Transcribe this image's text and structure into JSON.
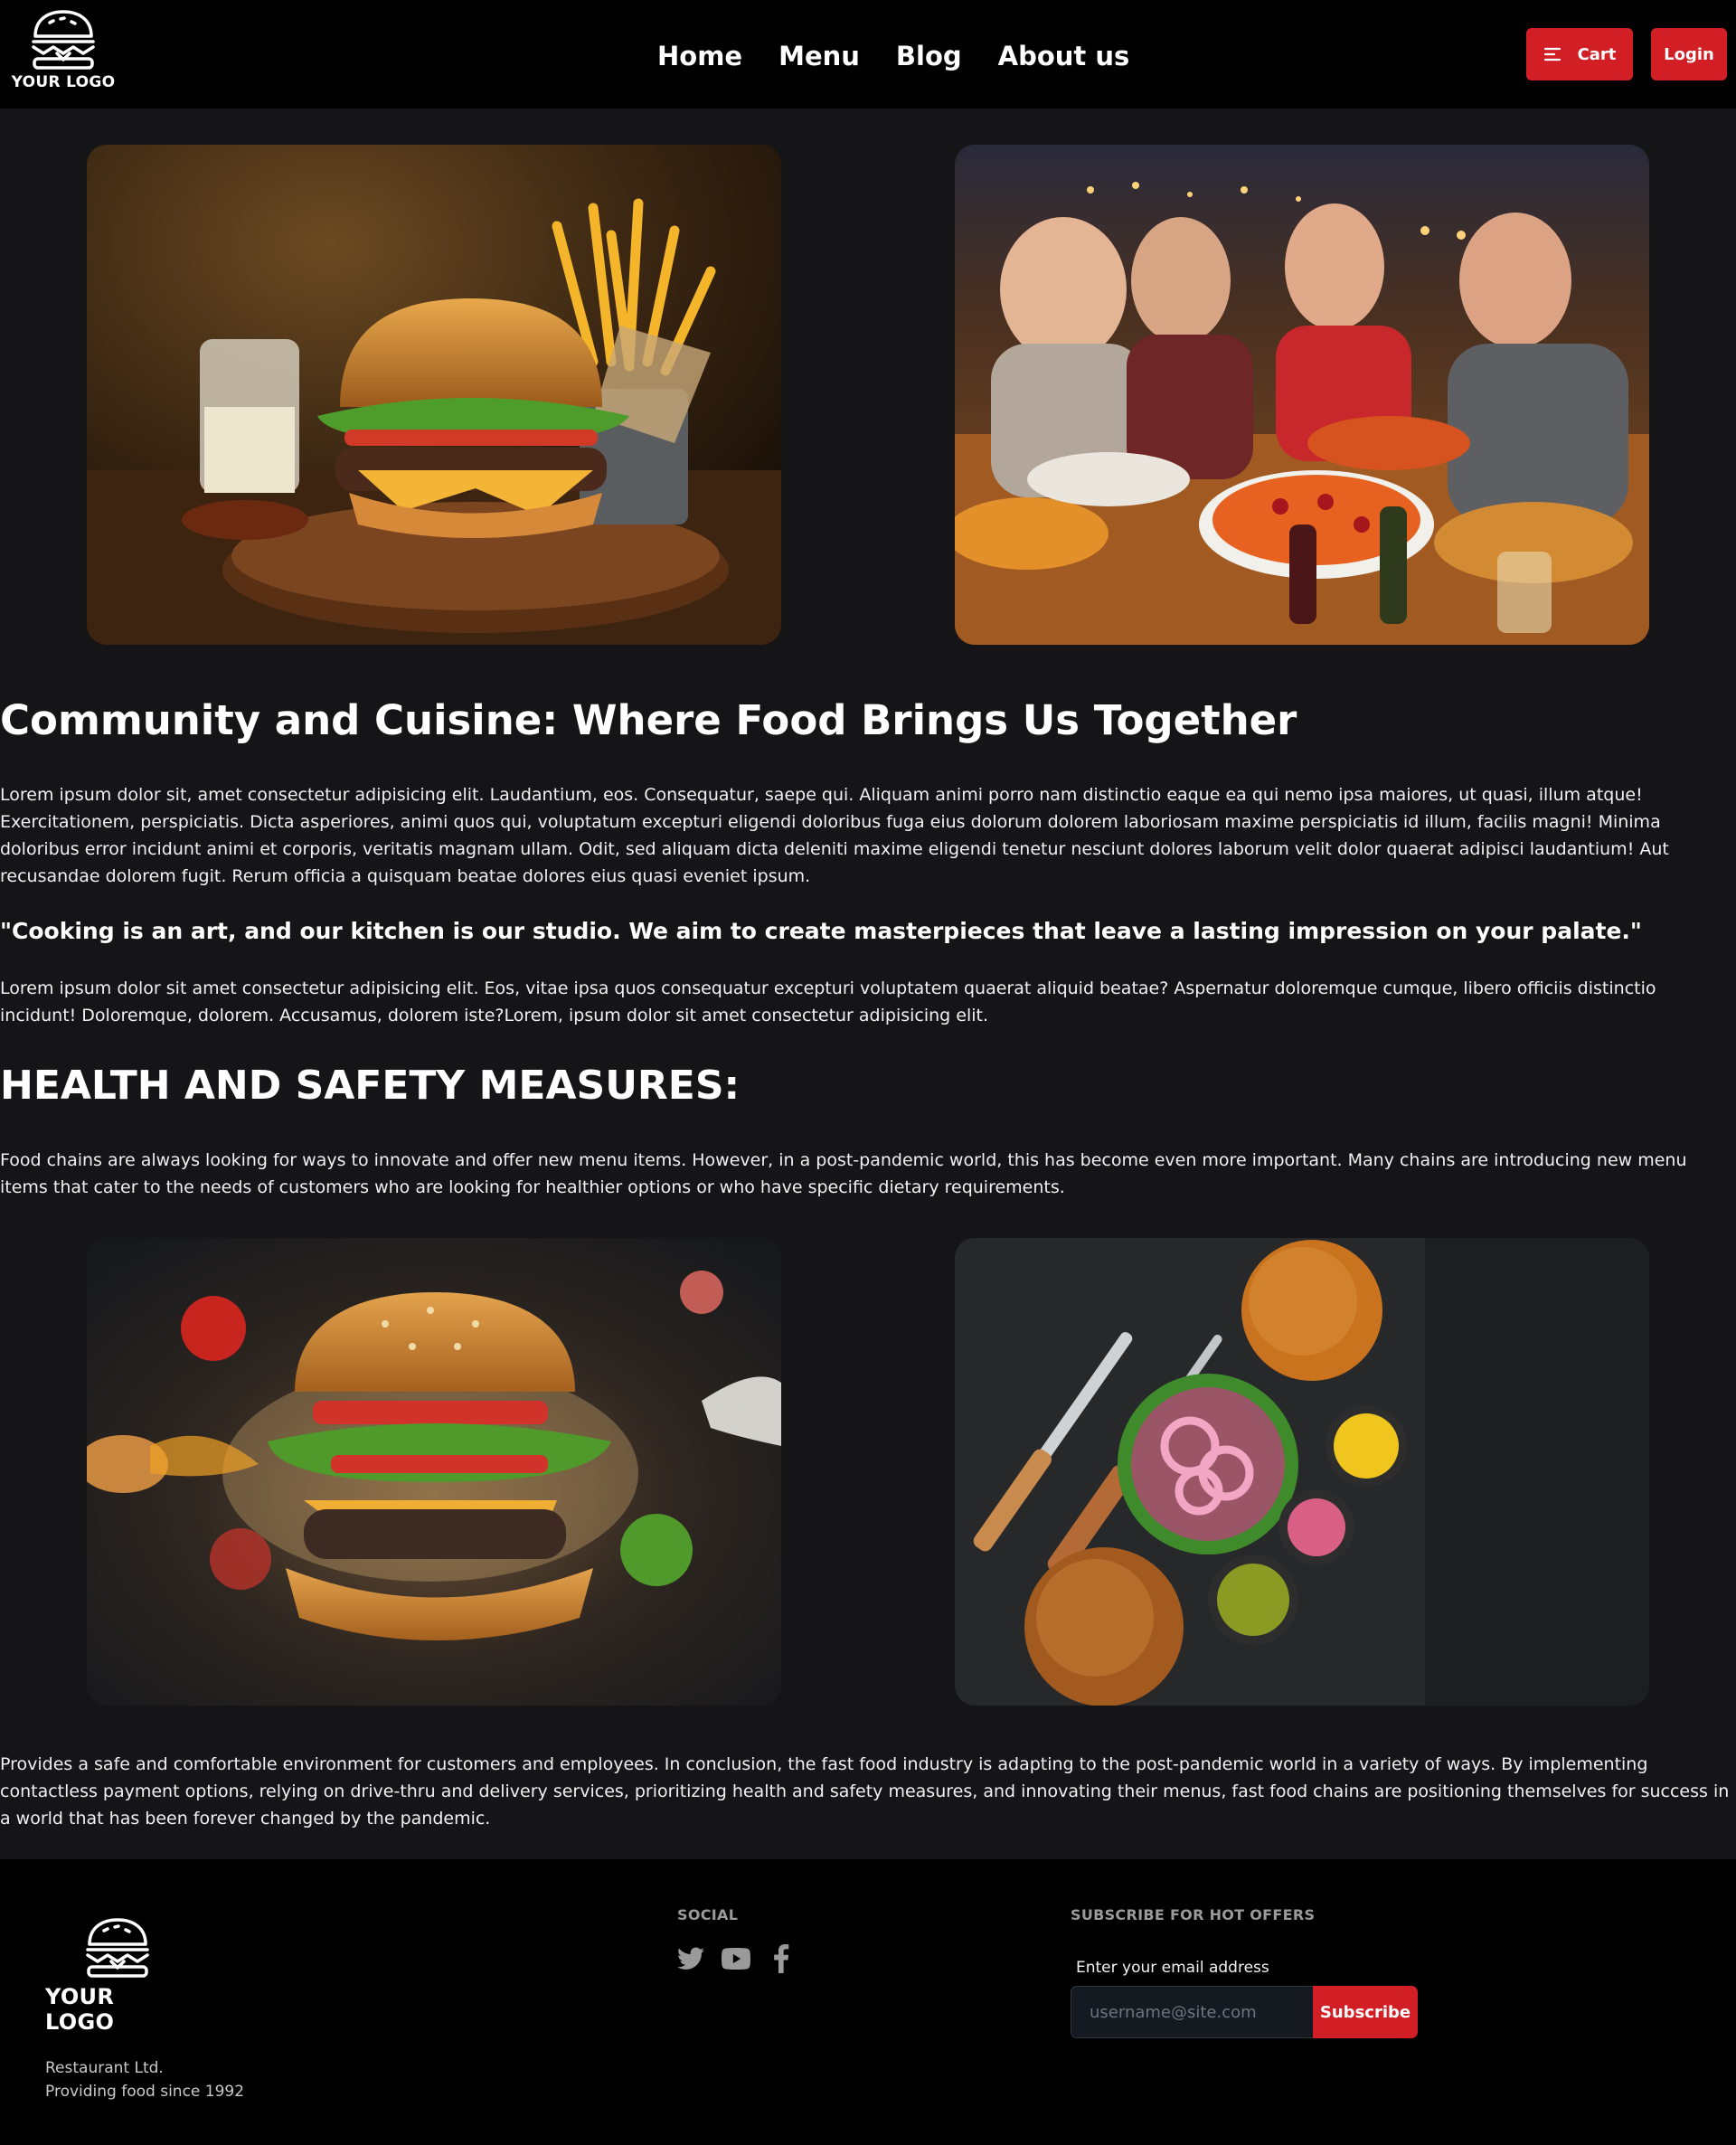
{
  "header": {
    "logo_text": "YOUR LOGO",
    "nav": [
      "Home",
      "Menu",
      "Blog",
      "About us"
    ],
    "cart_label": "Cart",
    "login_label": "Login"
  },
  "content": {
    "heading": "Community and Cuisine: Where Food Brings Us Together",
    "paragraph1": "Lorem ipsum dolor sit, amet consectetur adipisicing elit. Laudantium, eos. Consequatur, saepe qui. Aliquam animi porro nam distinctio eaque ea qui nemo ipsa maiores, ut quasi, illum atque! Exercitationem, perspiciatis. Dicta asperiores, animi quos qui, voluptatum excepturi eligendi doloribus fuga eius dolorum dolorem laboriosam maxime perspiciatis id illum, facilis magni! Minima doloribus error incidunt animi et corporis, veritatis magnam ullam. Odit, sed aliquam dicta deleniti maxime eligendi tenetur nesciunt dolores laborum velit dolor quaerat adipisci laudantium! Aut recusandae dolorem fugit. Rerum officia a quisquam beatae dolores eius quasi eveniet ipsum.",
    "quote": "\"Cooking is an art, and our kitchen is our studio. We aim to create masterpieces that leave a lasting impression on your palate.\"",
    "paragraph2": "Lorem ipsum dolor sit amet consectetur adipisicing elit. Eos, vitae ipsa quos consequatur excepturi voluptatem quaerat aliquid beatae? Aspernatur doloremque cumque, libero officiis distinctio incidunt! Doloremque, dolorem. Accusamus, dolorem iste?Lorem, ipsum dolor sit amet consectetur adipisicing elit.",
    "heading2": "HEALTH AND SAFETY MEASURES:",
    "paragraph3": "Food chains are always looking for ways to innovate and offer new menu items. However, in a post-pandemic world, this has become even more important. Many chains are introducing new menu items that cater to the needs of customers who are looking for healthier options or who have specific dietary requirements.",
    "paragraph4": "Provides a safe and comfortable environment for customers and employees. In conclusion, the fast food industry is adapting to the post-pandemic world in a variety of ways. By implementing contactless payment options, relying on drive-thru and delivery services, prioritizing health and safety measures, and innovating their menus, fast food chains are positioning themselves for success in a world that has been forever changed by the pandemic."
  },
  "footer": {
    "logo_text": "YOUR LOGO",
    "company_name": "Restaurant Ltd.",
    "company_tagline": "Providing food since 1992",
    "social_heading": "SOCIAL",
    "social_icons": [
      "twitter-icon",
      "youtube-icon",
      "facebook-icon"
    ],
    "subscribe_heading": "SUBSCRIBE FOR HOT OFFERS",
    "email_label": "Enter your email address",
    "email_placeholder": "username@site.com",
    "subscribe_label": "Subscribe"
  },
  "colors": {
    "accent": "#d21f26",
    "background": "#151517",
    "header_bg": "#000000"
  }
}
